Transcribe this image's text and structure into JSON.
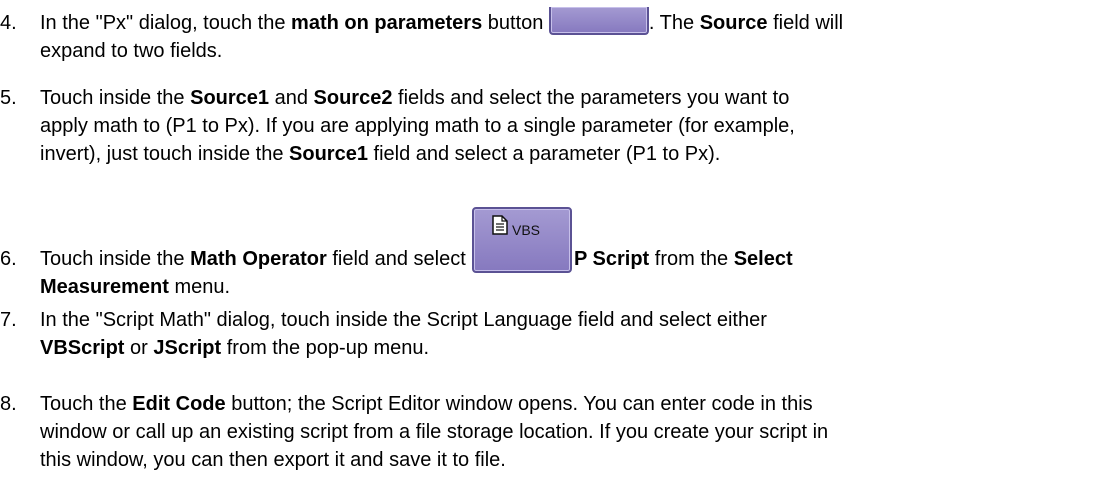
{
  "steps": [
    {
      "num": "4.",
      "parts": [
        "In the \"Px\" dialog, touch the ",
        "math on parameters",
        " button ",
        ". The ",
        "Source",
        " field will",
        "expand to two fields."
      ]
    },
    {
      "num": "5.",
      "lines": [
        "Touch inside the ",
        "Source1",
        " and ",
        "Source2",
        " fields and select the parameters you want to",
        "apply math to (P1 to Px). If you are applying math to a single parameter (for example,",
        "invert), just touch inside the ",
        "Source1",
        " field and select a parameter (P1 to Px)."
      ]
    },
    {
      "num": "6.",
      "icon_label": "VBS",
      "parts": [
        "Touch inside the ",
        "Math Operator",
        " field and select ",
        "P Script",
        " from the ",
        "Select",
        "Measurement",
        " menu."
      ]
    },
    {
      "num": "7.",
      "parts": [
        "In the \"Script Math\" dialog, touch inside the Script Language field and select either",
        "VBScript",
        " or ",
        "JScript",
        " from the pop-up menu."
      ]
    },
    {
      "num": "8.",
      "parts": [
        "Touch the ",
        "Edit Code",
        " button; the Script Editor window opens. You can enter code in this",
        "window or call up an existing script from a file storage location. If you create your script in",
        "this window, you can then export it and save it to file."
      ]
    }
  ]
}
